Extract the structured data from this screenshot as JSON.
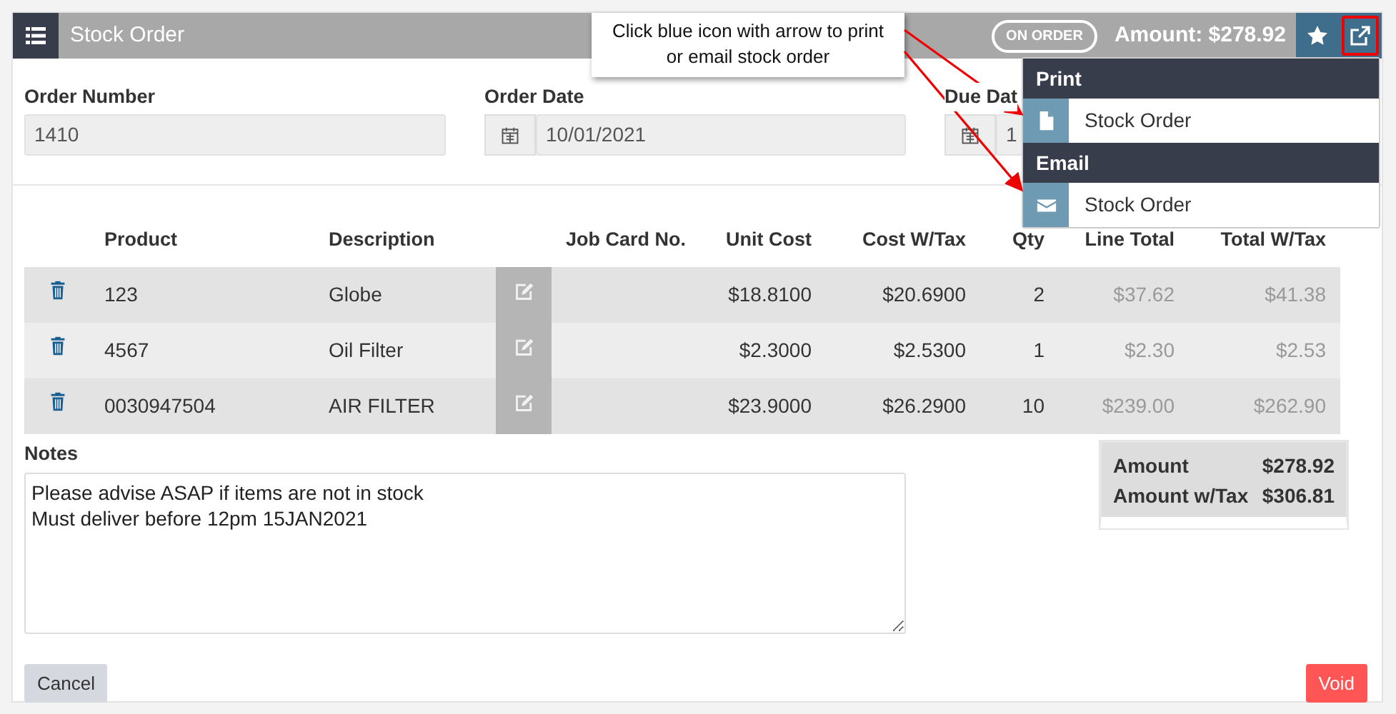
{
  "header": {
    "title": "Stock Order",
    "status": "ON ORDER",
    "amount": "Amount: $278.92",
    "actions": [
      {
        "kind": "star",
        "highlighted": false
      },
      {
        "kind": "export",
        "highlighted": true
      }
    ]
  },
  "callout": {
    "text": "Click blue icon with arrow to print or email stock order"
  },
  "menu": {
    "sections": [
      {
        "heading": "Print",
        "items": [
          {
            "kind": "print",
            "label": "Stock Order"
          }
        ]
      },
      {
        "heading": "Email",
        "items": [
          {
            "kind": "email",
            "label": "Stock Order"
          }
        ]
      }
    ]
  },
  "fields": [
    {
      "kind": "text",
      "label": "Order Number",
      "value": "1410"
    },
    {
      "kind": "date",
      "label": "Order Date",
      "value": "10/01/2021"
    },
    {
      "kind": "date",
      "label": "Due Dat",
      "value": "1"
    }
  ],
  "table": {
    "columns": [
      "Product",
      "Description",
      "Job Card No.",
      "Unit Cost",
      "Cost W/Tax",
      "Qty",
      "Line Total",
      "Total W/Tax"
    ],
    "rows": [
      {
        "product": "123",
        "description": "Globe",
        "unit_cost": "$18.8100",
        "cost_w_tax": "$20.6900",
        "qty": "2",
        "line_total": "$37.62",
        "total_w_tax": "$41.38"
      },
      {
        "product": "4567",
        "description": "Oil Filter",
        "unit_cost": "$2.3000",
        "cost_w_tax": "$2.5300",
        "qty": "1",
        "line_total": "$2.30",
        "total_w_tax": "$2.53"
      },
      {
        "product": "0030947504",
        "description": "AIR FILTER",
        "unit_cost": "$23.9000",
        "cost_w_tax": "$26.2900",
        "qty": "10",
        "line_total": "$239.00",
        "total_w_tax": "$262.90"
      }
    ]
  },
  "notes": {
    "label": "Notes",
    "value": "Please advise ASAP if items are not in stock\nMust deliver before 12pm 15JAN2021"
  },
  "totals": [
    {
      "label": "Amount",
      "value": "$278.92"
    },
    {
      "label": "Amount w/Tax",
      "value": "$306.81"
    }
  ],
  "buttons": {
    "cancel": "Cancel",
    "void": "Void"
  }
}
